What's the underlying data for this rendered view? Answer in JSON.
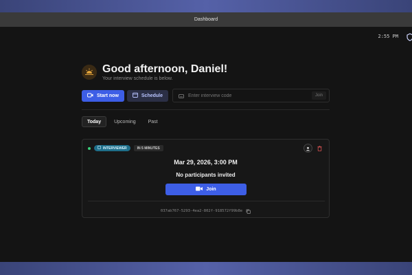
{
  "window": {
    "title": "Dashboard"
  },
  "status": {
    "time": "2:55 PM"
  },
  "greeting": {
    "title": "Good afternoon, Daniel!",
    "subtitle": "Your interview schedule is below."
  },
  "actions": {
    "start_label": "Start now",
    "schedule_label": "Schedule",
    "code_placeholder": "Enter interview code",
    "code_value": "",
    "join_label": "Join"
  },
  "tabs": [
    {
      "label": "Today",
      "active": true
    },
    {
      "label": "Upcoming",
      "active": false
    },
    {
      "label": "Past",
      "active": false
    }
  ],
  "interview": {
    "role_badge": "INTERVIEWER",
    "time_badge": "IN 5 MINUTES",
    "datetime": "Mar 29, 2026, 3:00 PM",
    "participants": "No participants invited",
    "join_label": "Join",
    "id": "037ab767-5293-4ea2-802f-918572f99b8e",
    "status_color": "#3ad07a"
  },
  "colors": {
    "accent": "#3d5ee6",
    "role_badge": "#1f6f8a",
    "danger": "#e05555"
  }
}
